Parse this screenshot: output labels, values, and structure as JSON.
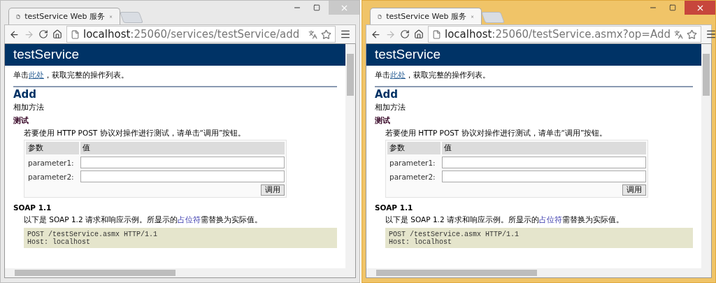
{
  "windows": [
    {
      "active": false,
      "tab_title": "testService Web 服务",
      "url": {
        "host": "localhost",
        "path": ":25060/services/testService/add"
      },
      "page": {
        "banner": "testService",
        "intro": {
          "before": "单击",
          "link": "此处",
          "after": "，获取完整的操作列表。"
        },
        "operation": "Add",
        "description": "相加方法",
        "test_heading": "测试",
        "test_text": "若要使用 HTTP POST 协议对操作进行测试，请单击“调用”按钮。",
        "table": {
          "columns": [
            "参数",
            "值"
          ],
          "rows": [
            {
              "label": "parameter1:"
            },
            {
              "label": "parameter2:"
            }
          ],
          "button": "调用"
        },
        "soap_heading": "SOAP 1.1",
        "soap_text": {
          "before": "以下是 SOAP 1.2 请求和响应示例。所显示的",
          "link": "占位符",
          "after": "需替换为实际值。"
        },
        "code": [
          "POST /testService.asmx HTTP/1.1",
          "Host: localhost"
        ]
      }
    },
    {
      "active": true,
      "tab_title": "testService Web 服务",
      "url": {
        "host": "localhost",
        "path": ":25060/testService.asmx?op=Add"
      },
      "page": {
        "banner": "testService",
        "intro": {
          "before": "单击",
          "link": "此处",
          "after": "，获取完整的操作列表。"
        },
        "operation": "Add",
        "description": "相加方法",
        "test_heading": "测试",
        "test_text": "若要使用 HTTP POST 协议对操作进行测试，请单击“调用”按钮。",
        "table": {
          "columns": [
            "参数",
            "值"
          ],
          "rows": [
            {
              "label": "parameter1:"
            },
            {
              "label": "parameter2:"
            }
          ],
          "button": "调用"
        },
        "soap_heading": "SOAP 1.1",
        "soap_text": {
          "before": "以下是 SOAP 1.2 请求和响应示例。所显示的",
          "link": "占位符",
          "after": "需替换为实际值。"
        },
        "code": [
          "POST /testService.asmx HTTP/1.1",
          "Host: localhost"
        ]
      }
    }
  ]
}
